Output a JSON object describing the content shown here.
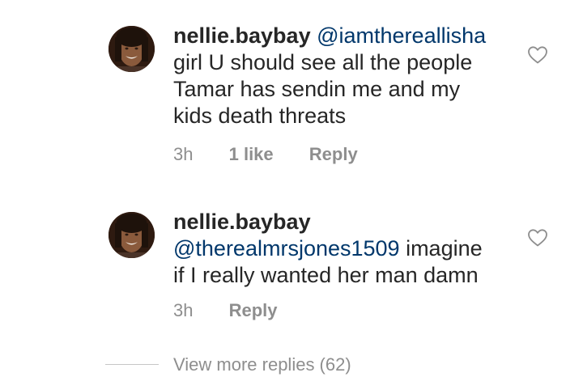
{
  "comments": [
    {
      "username": "nellie.baybay",
      "mention": "@iamthereallisha",
      "text_lines": [
        "girl U should see all the people",
        "Tamar has sendin me and my",
        "kids death threats"
      ],
      "time": "3h",
      "likes": "1 like",
      "reply": "Reply",
      "icons": {
        "avatar": "profile-photo",
        "like": "heart-outline-icon"
      }
    },
    {
      "username": "nellie.baybay",
      "mention": "@therealmrsjones1509",
      "text_after_mention": " imagine",
      "text_lines": [
        "if I really wanted her man damn"
      ],
      "time": "3h",
      "reply": "Reply",
      "icons": {
        "avatar": "profile-photo",
        "like": "heart-outline-icon"
      }
    }
  ],
  "view_more": "View more replies (62)",
  "colors": {
    "text": "#262626",
    "mention": "#00376b",
    "secondary": "#8e8e8e",
    "divider": "#c7c7c7"
  }
}
